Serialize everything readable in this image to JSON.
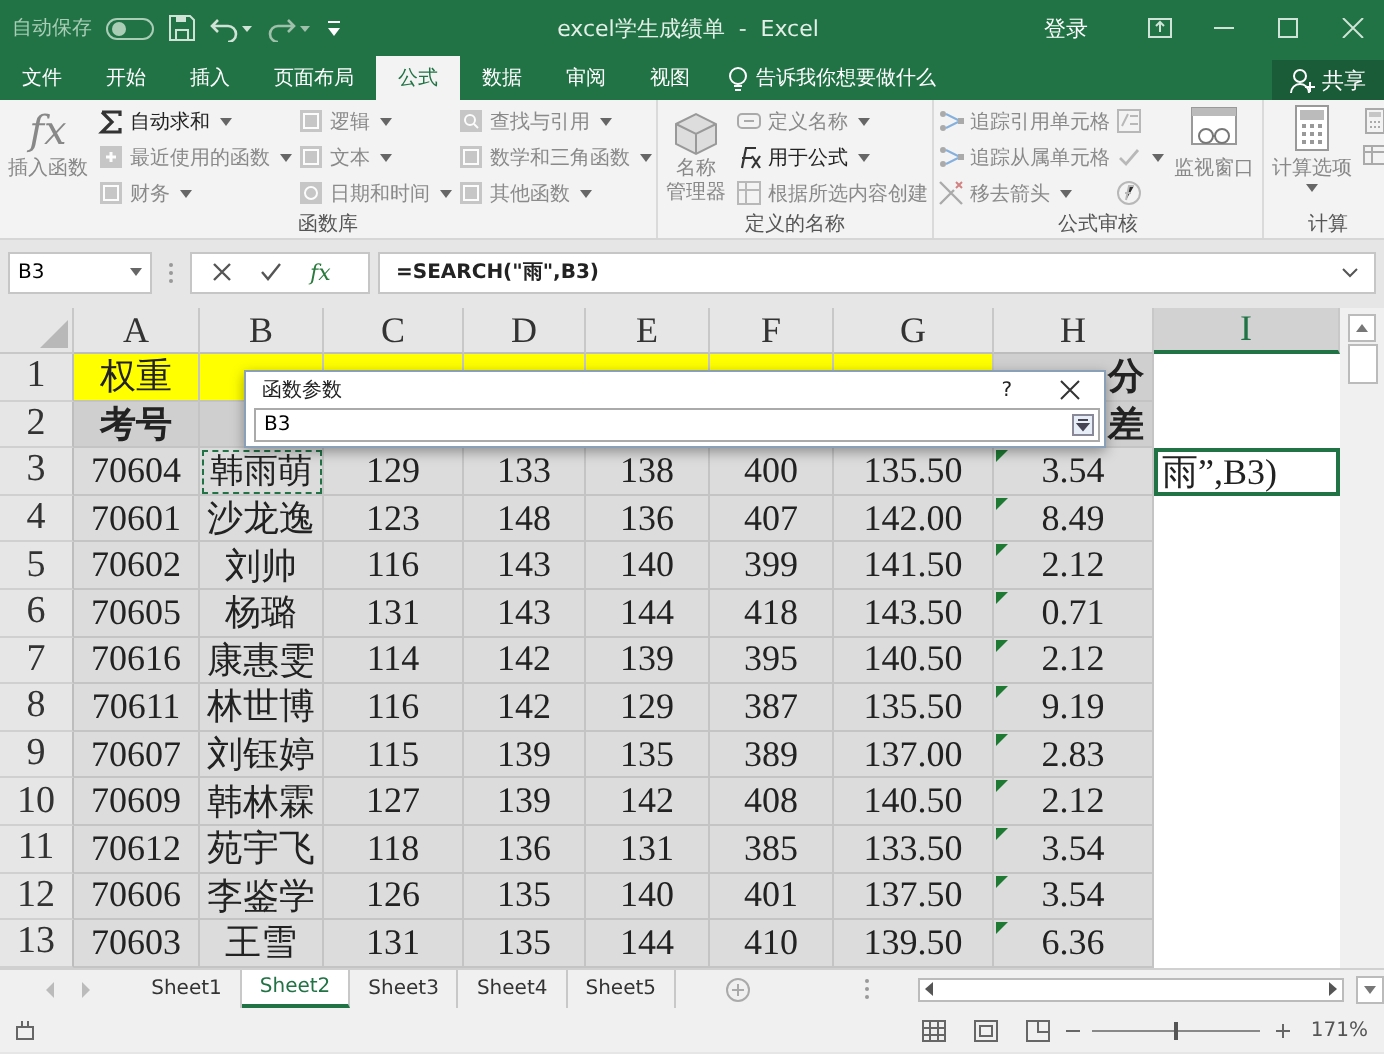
{
  "title_bar": {
    "autosave_label": "自动保存",
    "autosave_on": false,
    "title": "excel学生成绩单  -  Excel",
    "sign_in": "登录"
  },
  "ribbon_tabs": [
    {
      "label": "文件",
      "selected": false
    },
    {
      "label": "开始",
      "selected": false
    },
    {
      "label": "插入",
      "selected": false
    },
    {
      "label": "页面布局",
      "selected": false
    },
    {
      "label": "公式",
      "selected": true
    },
    {
      "label": "数据",
      "selected": false
    },
    {
      "label": "审阅",
      "selected": false
    },
    {
      "label": "视图",
      "selected": false
    }
  ],
  "tell_me": "告诉我你想要做什么",
  "share": "共享",
  "ribbon_groups": [
    {
      "label": "函数库",
      "blocks": [
        {
          "kind": "big",
          "lines": [
            "插入函数"
          ],
          "glyph": "fx",
          "disabled": true
        },
        {
          "kind": "column",
          "items": [
            {
              "label": "自动求和",
              "kind": "sum",
              "dropdown": true,
              "disabled": false
            },
            {
              "label": "最近使用的函数",
              "kind": "star",
              "dropdown": true,
              "disabled": true
            },
            {
              "label": "财务",
              "kind": "book",
              "dropdown": true,
              "disabled": true
            }
          ]
        },
        {
          "kind": "column",
          "items": [
            {
              "label": "逻辑",
              "kind": "book",
              "dropdown": true,
              "disabled": true
            },
            {
              "label": "文本",
              "kind": "book",
              "dropdown": true,
              "disabled": true
            },
            {
              "label": "日期和时间",
              "kind": "clock",
              "dropdown": true,
              "disabled": true
            }
          ]
        },
        {
          "kind": "column",
          "items": [
            {
              "label": "查找与引用",
              "kind": "search",
              "dropdown": true,
              "disabled": true
            },
            {
              "label": "数学和三角函数",
              "kind": "book",
              "dropdown": true,
              "disabled": true
            },
            {
              "label": "其他函数",
              "kind": "book",
              "dropdown": true,
              "disabled": true
            }
          ]
        }
      ]
    },
    {
      "label": "定义的名称",
      "blocks": [
        {
          "kind": "big",
          "lines": [
            "名称",
            "管理器"
          ],
          "disabled": true
        },
        {
          "kind": "column",
          "items": [
            {
              "label": "定义名称",
              "kind": "tag",
              "dropdown": true,
              "disabled": true
            },
            {
              "label": "用于公式",
              "kind": "formula",
              "dropdown": true,
              "disabled": false
            },
            {
              "label": "根据所选内容创建",
              "kind": "table",
              "dropdown": false,
              "disabled": true
            }
          ]
        }
      ]
    },
    {
      "label": "公式审核",
      "blocks": [
        {
          "kind": "column",
          "items": [
            {
              "label": "追踪引用单元格",
              "kind": "trace",
              "dropdown": false,
              "disabled": true
            },
            {
              "label": "追踪从属单元格",
              "kind": "trace",
              "dropdown": false,
              "disabled": true
            },
            {
              "label": "移去箭头",
              "kind": "remove",
              "dropdown": true,
              "disabled": true
            }
          ]
        },
        {
          "kind": "column",
          "items": [
            {
              "kind": "show",
              "dropdown": false,
              "disabled": true
            },
            {
              "kind": "check",
              "dropdown": true,
              "disabled": true
            },
            {
              "kind": "evaluate",
              "dropdown": false,
              "disabled": true
            }
          ]
        },
        {
          "kind": "big",
          "lines": [
            "监视窗口"
          ],
          "disabled": true
        }
      ]
    },
    {
      "label": "计算",
      "blocks": [
        {
          "kind": "big",
          "lines": [
            "计算选项"
          ],
          "dropdown": true,
          "disabled": true
        },
        {
          "kind": "column",
          "items": [
            {
              "kind": "calc",
              "dropdown": false,
              "disabled": true
            },
            {
              "kind": "sheet",
              "dropdown": false,
              "disabled": true
            }
          ]
        }
      ]
    }
  ],
  "formula_bar": {
    "name_box": "B3",
    "fx": "fx",
    "formula": "=SEARCH(\"雨\",B3)"
  },
  "sheet": {
    "columns": [
      {
        "label": "A",
        "selected": false
      },
      {
        "label": "B",
        "selected": false
      },
      {
        "label": "C",
        "selected": false
      },
      {
        "label": "D",
        "selected": false
      },
      {
        "label": "E",
        "selected": false
      },
      {
        "label": "F",
        "selected": false
      },
      {
        "label": "G",
        "selected": false
      },
      {
        "label": "H",
        "selected": false
      },
      {
        "label": "I",
        "selected": true
      }
    ],
    "rows": [
      {
        "header": "1",
        "kind": "weight",
        "flagged": false,
        "cells": [
          {
            "text": "权重",
            "marquee": false
          },
          {
            "marquee": false
          },
          {
            "marquee": false
          },
          {
            "marquee": false
          },
          {
            "marquee": false
          },
          {
            "marquee": false
          },
          {
            "marquee": false
          },
          {
            "text": "分",
            "marquee": false
          }
        ]
      },
      {
        "header": "2",
        "kind": "header",
        "flagged": false,
        "cells": [
          {
            "text": "考号",
            "marquee": false
          },
          {
            "marquee": false
          },
          null,
          null,
          null,
          null,
          null,
          {
            "text": "差",
            "marquee": false
          }
        ]
      },
      {
        "header": "3",
        "kind": "data",
        "flagged": true,
        "edit_text": "雨”,B3)",
        "cells": [
          {
            "text": "70604",
            "marquee": false
          },
          {
            "text": "韩雨萌",
            "marquee": true
          },
          {
            "text": "129",
            "marquee": false
          },
          {
            "text": "133",
            "marquee": false
          },
          {
            "text": "138",
            "marquee": false
          },
          {
            "text": "400",
            "marquee": false
          },
          {
            "text": "135.50",
            "marquee": false
          },
          {
            "text": "3.54",
            "marquee": false
          }
        ]
      },
      {
        "header": "4",
        "kind": "data",
        "flagged": true,
        "cells": [
          {
            "text": "70601",
            "marquee": false
          },
          {
            "text": "沙龙逸",
            "marquee": false
          },
          {
            "text": "123",
            "marquee": false
          },
          {
            "text": "148",
            "marquee": false
          },
          {
            "text": "136",
            "marquee": false
          },
          {
            "text": "407",
            "marquee": false
          },
          {
            "text": "142.00",
            "marquee": false
          },
          {
            "text": "8.49",
            "marquee": false
          }
        ]
      },
      {
        "header": "5",
        "kind": "data",
        "flagged": true,
        "cells": [
          {
            "text": "70602",
            "marquee": false
          },
          {
            "text": "刘帅",
            "marquee": false
          },
          {
            "text": "116",
            "marquee": false
          },
          {
            "text": "143",
            "marquee": false
          },
          {
            "text": "140",
            "marquee": false
          },
          {
            "text": "399",
            "marquee": false
          },
          {
            "text": "141.50",
            "marquee": false
          },
          {
            "text": "2.12",
            "marquee": false
          }
        ]
      },
      {
        "header": "6",
        "kind": "data",
        "flagged": true,
        "cells": [
          {
            "text": "70605",
            "marquee": false
          },
          {
            "text": "杨璐",
            "marquee": false
          },
          {
            "text": "131",
            "marquee": false
          },
          {
            "text": "143",
            "marquee": false
          },
          {
            "text": "144",
            "marquee": false
          },
          {
            "text": "418",
            "marquee": false
          },
          {
            "text": "143.50",
            "marquee": false
          },
          {
            "text": "0.71",
            "marquee": false
          }
        ]
      },
      {
        "header": "7",
        "kind": "data",
        "flagged": true,
        "cells": [
          {
            "text": "70616",
            "marquee": false
          },
          {
            "text": "康惠雯",
            "marquee": false
          },
          {
            "text": "114",
            "marquee": false
          },
          {
            "text": "142",
            "marquee": false
          },
          {
            "text": "139",
            "marquee": false
          },
          {
            "text": "395",
            "marquee": false
          },
          {
            "text": "140.50",
            "marquee": false
          },
          {
            "text": "2.12",
            "marquee": false
          }
        ]
      },
      {
        "header": "8",
        "kind": "data",
        "flagged": true,
        "cells": [
          {
            "text": "70611",
            "marquee": false
          },
          {
            "text": "林世博",
            "marquee": false
          },
          {
            "text": "116",
            "marquee": false
          },
          {
            "text": "142",
            "marquee": false
          },
          {
            "text": "129",
            "marquee": false
          },
          {
            "text": "387",
            "marquee": false
          },
          {
            "text": "135.50",
            "marquee": false
          },
          {
            "text": "9.19",
            "marquee": false
          }
        ]
      },
      {
        "header": "9",
        "kind": "data",
        "flagged": true,
        "cells": [
          {
            "text": "70607",
            "marquee": false
          },
          {
            "text": "刘钰婷",
            "marquee": false
          },
          {
            "text": "115",
            "marquee": false
          },
          {
            "text": "139",
            "marquee": false
          },
          {
            "text": "135",
            "marquee": false
          },
          {
            "text": "389",
            "marquee": false
          },
          {
            "text": "137.00",
            "marquee": false
          },
          {
            "text": "2.83",
            "marquee": false
          }
        ]
      },
      {
        "header": "10",
        "kind": "data",
        "flagged": true,
        "cells": [
          {
            "text": "70609",
            "marquee": false
          },
          {
            "text": "韩林霖",
            "marquee": false
          },
          {
            "text": "127",
            "marquee": false
          },
          {
            "text": "139",
            "marquee": false
          },
          {
            "text": "142",
            "marquee": false
          },
          {
            "text": "408",
            "marquee": false
          },
          {
            "text": "140.50",
            "marquee": false
          },
          {
            "text": "2.12",
            "marquee": false
          }
        ]
      },
      {
        "header": "11",
        "kind": "data",
        "flagged": true,
        "cells": [
          {
            "text": "70612",
            "marquee": false
          },
          {
            "text": "苑宇飞",
            "marquee": false
          },
          {
            "text": "118",
            "marquee": false
          },
          {
            "text": "136",
            "marquee": false
          },
          {
            "text": "131",
            "marquee": false
          },
          {
            "text": "385",
            "marquee": false
          },
          {
            "text": "133.50",
            "marquee": false
          },
          {
            "text": "3.54",
            "marquee": false
          }
        ]
      },
      {
        "header": "12",
        "kind": "data",
        "flagged": true,
        "cells": [
          {
            "text": "70606",
            "marquee": false
          },
          {
            "text": "李鉴学",
            "marquee": false
          },
          {
            "text": "126",
            "marquee": false
          },
          {
            "text": "135",
            "marquee": false
          },
          {
            "text": "140",
            "marquee": false
          },
          {
            "text": "401",
            "marquee": false
          },
          {
            "text": "137.50",
            "marquee": false
          },
          {
            "text": "3.54",
            "marquee": false
          }
        ]
      },
      {
        "header": "13",
        "kind": "data",
        "flagged": true,
        "cells": [
          {
            "text": "70603",
            "marquee": false
          },
          {
            "text": "王雪",
            "marquee": false
          },
          {
            "text": "131",
            "marquee": false
          },
          {
            "text": "135",
            "marquee": false
          },
          {
            "text": "144",
            "marquee": false
          },
          {
            "text": "410",
            "marquee": false
          },
          {
            "text": "139.50",
            "marquee": false
          },
          {
            "text": "6.36",
            "marquee": false
          }
        ]
      }
    ]
  },
  "dialog": {
    "title": "函数参数",
    "help": "?",
    "value": "B3"
  },
  "sheet_tabs": [
    {
      "label": "Sheet1",
      "selected": false
    },
    {
      "label": "Sheet2",
      "selected": true
    },
    {
      "label": "Sheet3",
      "selected": false
    },
    {
      "label": "Sheet4",
      "selected": false
    },
    {
      "label": "Sheet5",
      "selected": false
    }
  ],
  "status_bar": {
    "zoom": "171%",
    "zoom_slider": {
      "level": 0.5
    }
  }
}
